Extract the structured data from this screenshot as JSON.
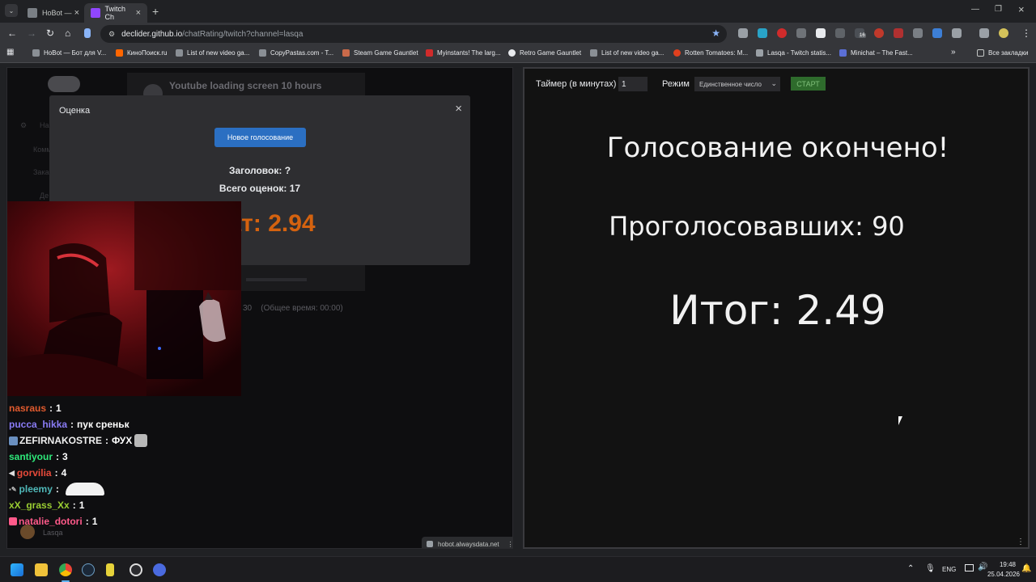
{
  "browser": {
    "tabs": [
      {
        "title": "HoBot —",
        "active": false
      },
      {
        "title": "Twitch Ch",
        "active": true
      }
    ],
    "url_host": "declider.github.io",
    "url_path": "/chatRating/twitch?channel=lasqa",
    "bookmarks": [
      "HoBot — Бот для V...",
      "КиноПоиск.ru",
      "List of new video ga...",
      "CopyPastas.com - T...",
      "Steam Game Gauntlet",
      "Myinstants! The larg...",
      "Retro Game Gauntlet",
      "List of new video ga...",
      "Rotten Tomatoes: M...",
      "Lasqa - Twitch statis...",
      "Minichat – The Fast..."
    ],
    "all_bookmarks": "Все закладки",
    "extension_badge": "16"
  },
  "left_page": {
    "bg_video_title": "Youtube loading screen 10 hours",
    "bg_total_time": "30    (Общее время: 00:00)",
    "bg_sidebar": [
      "На",
      "Комм",
      "Зака",
      "Де"
    ],
    "bg_user": "Lasqa",
    "status_url": "hobot.alwaysdata.net",
    "dialog": {
      "title": "Оценка",
      "new_vote_button": "Новое голосование",
      "heading_line": "Заголовок: ?",
      "total_line": "Всего оценок: 17",
      "result_line": "ьтат: 2.94"
    },
    "chat": [
      {
        "user": "nasraus",
        "text": "1",
        "color": "#e05a2e"
      },
      {
        "user": "pucca_hikka",
        "text": "пук среньк",
        "color": "#8a7cf5"
      },
      {
        "user": "ZEFIRNAKOSTRE",
        "text": "ФУХ",
        "color": "#f0f0f0"
      },
      {
        "user": "santiyour",
        "text": "3",
        "color": "#2ee87a"
      },
      {
        "user": "gorvilia",
        "text": "4",
        "color": "#e84a3a"
      },
      {
        "user": "pleemy",
        "text": "",
        "color": "#4fb8b8"
      },
      {
        "user": "xX_grass_Xx",
        "text": "1",
        "color": "#9acd32"
      },
      {
        "user": "natalie_dotori",
        "text": "1",
        "color": "#ff5a8a"
      }
    ]
  },
  "right_page": {
    "timer_label": "Таймер (в минутах)",
    "timer_value": "1",
    "mode_label": "Режим",
    "mode_value": "Единственное число",
    "start_button": "СТАРТ",
    "vote_over": "Голосование окончено!",
    "voters": "Проголосовавших: 90",
    "total": "Итог: 2.49"
  },
  "taskbar": {
    "lang": "ENG",
    "time": "19:48",
    "date": "25.04.2026"
  }
}
